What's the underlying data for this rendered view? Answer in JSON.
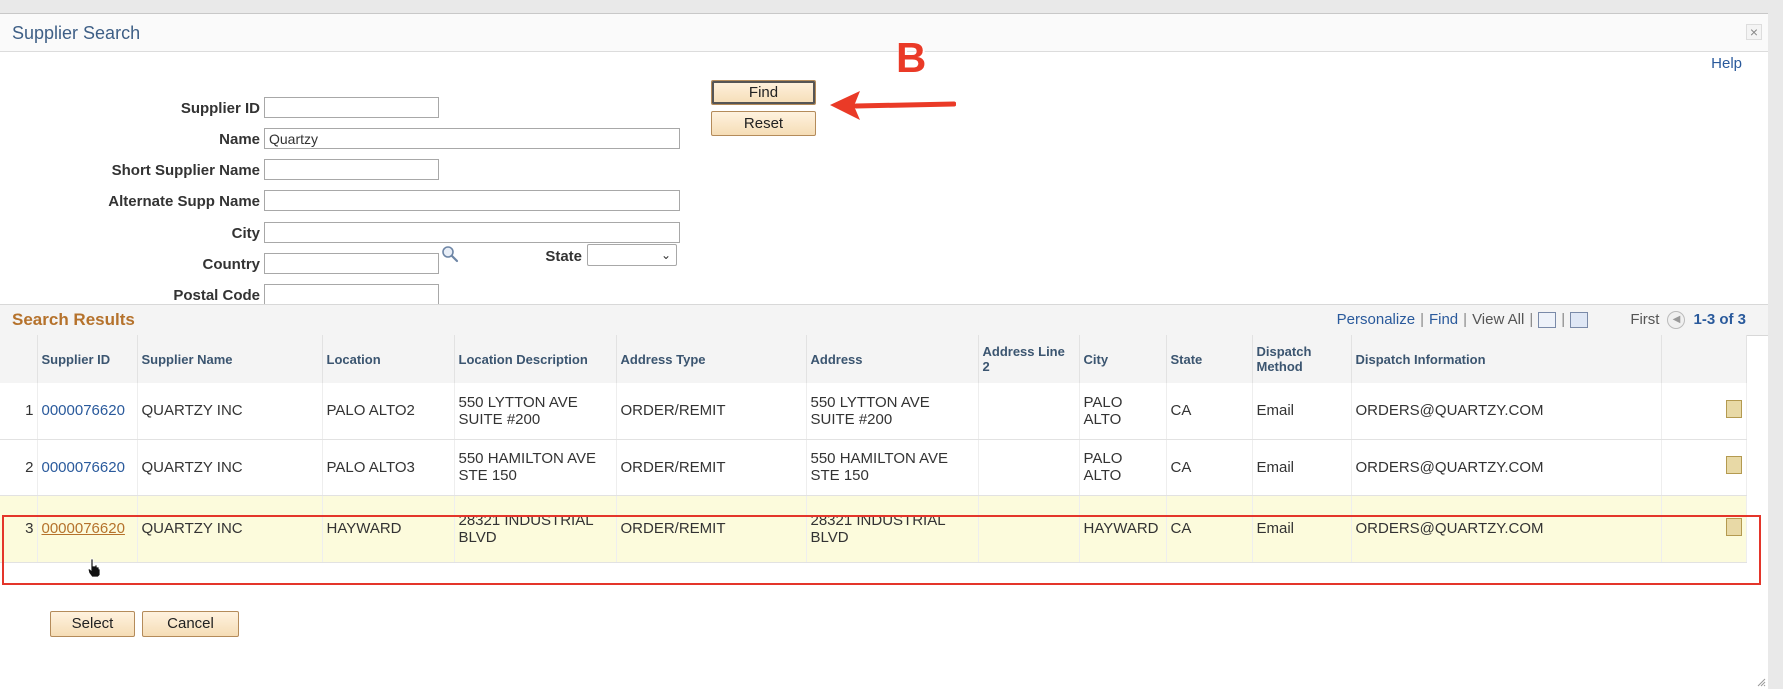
{
  "dialog": {
    "title": "Supplier Search",
    "close_glyph": "×",
    "help": "Help"
  },
  "form": {
    "supplier_id": {
      "label": "Supplier ID",
      "value": ""
    },
    "name": {
      "label": "Name",
      "value": "Quartzy"
    },
    "short_name": {
      "label": "Short Supplier Name",
      "value": ""
    },
    "alt_name": {
      "label": "Alternate Supp Name",
      "value": ""
    },
    "city": {
      "label": "City",
      "value": ""
    },
    "country": {
      "label": "Country",
      "value": ""
    },
    "state": {
      "label": "State",
      "value": ""
    },
    "postal": {
      "label": "Postal Code",
      "value": ""
    },
    "find_label": "Find",
    "reset_label": "Reset"
  },
  "annotation": {
    "letter": "B",
    "color": "#ea3a27"
  },
  "results": {
    "title": "Search Results",
    "toolbar": {
      "personalize": "Personalize",
      "find": "Find",
      "view_all": "View All",
      "first": "First",
      "range": "1-3 of 3"
    },
    "columns": [
      "Supplier ID",
      "Supplier Name",
      "Location",
      "Location Description",
      "Address Type",
      "Address",
      "Address Line 2",
      "City",
      "State",
      "Dispatch Method",
      "Dispatch Information"
    ],
    "rows": [
      {
        "num": "1",
        "supplier_id": "0000076620",
        "supplier_name": "QUARTZY INC",
        "location": "PALO ALTO2",
        "location_desc": "550 LYTTON AVE SUITE #200",
        "address_type": "ORDER/REMIT",
        "address": "550 LYTTON AVE SUITE #200",
        "address2": "",
        "city": "PALO ALTO",
        "state": "CA",
        "dispatch_method": "Email",
        "dispatch_info": "ORDERS@QUARTZY.COM"
      },
      {
        "num": "2",
        "supplier_id": "0000076620",
        "supplier_name": "QUARTZY INC",
        "location": "PALO ALTO3",
        "location_desc": "550 HAMILTON AVE STE 150",
        "address_type": "ORDER/REMIT",
        "address": "550 HAMILTON AVE STE 150",
        "address2": "",
        "city": "PALO ALTO",
        "state": "CA",
        "dispatch_method": "Email",
        "dispatch_info": "ORDERS@QUARTZY.COM"
      },
      {
        "num": "3",
        "supplier_id": "0000076620",
        "supplier_name": "QUARTZY INC",
        "location": "HAYWARD",
        "location_desc": "28321 INDUSTRIAL BLVD",
        "address_type": "ORDER/REMIT",
        "address": "28321 INDUSTRIAL BLVD",
        "address2": "",
        "city": "HAYWARD",
        "state": "CA",
        "dispatch_method": "Email",
        "dispatch_info": "ORDERS@QUARTZY.COM"
      }
    ]
  },
  "footer": {
    "select_label": "Select",
    "cancel_label": "Cancel"
  },
  "colors": {
    "title": "#3e5f86",
    "link": "#2a5a9c",
    "section_title": "#b5722c",
    "highlight_border": "#e4352a",
    "selected_row_bg": "#fcfbdc",
    "button_bg": "#f5ddb6"
  },
  "icons": {
    "lookup": "magnifier-icon",
    "close": "close-icon",
    "pointer": "hand-cursor-icon"
  }
}
